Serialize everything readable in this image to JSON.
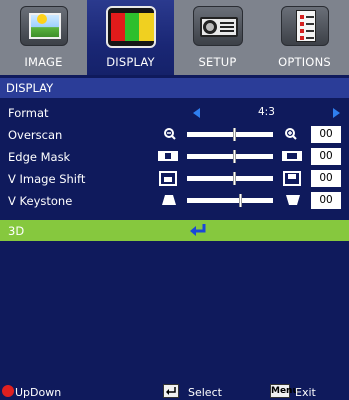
{
  "tabs": [
    {
      "label": "IMAGE",
      "icon": "image-icon",
      "active": false
    },
    {
      "label": "DISPLAY",
      "icon": "display-icon",
      "active": true
    },
    {
      "label": "SETUP",
      "icon": "projector-icon",
      "active": false
    },
    {
      "label": "OPTIONS",
      "icon": "checklist-icon",
      "active": false
    }
  ],
  "section_title": "DISPLAY",
  "rows": {
    "format": {
      "label": "Format",
      "value": "4:3"
    },
    "overscan": {
      "label": "Overscan",
      "value": "00",
      "level": 0.5
    },
    "edge_mask": {
      "label": "Edge Mask",
      "value": "00",
      "level": 0.5
    },
    "v_image_shift": {
      "label": "V Image Shift",
      "value": "00",
      "level": 0.5
    },
    "v_keystone": {
      "label": "V Keystone",
      "value": "00",
      "level": 0.6
    },
    "three_d": {
      "label": "3D",
      "icon": "enter-icon"
    }
  },
  "footer": {
    "updown_label": "UpDown",
    "select_label": "Select",
    "menu_key": "Menu",
    "exit_label": "Exit"
  },
  "colors": {
    "background": "#0f1a5c",
    "tabbar": "#7e838d",
    "section": "#2b3d98",
    "selected_row": "#86c83e",
    "arrow": "#2f7ff0"
  }
}
